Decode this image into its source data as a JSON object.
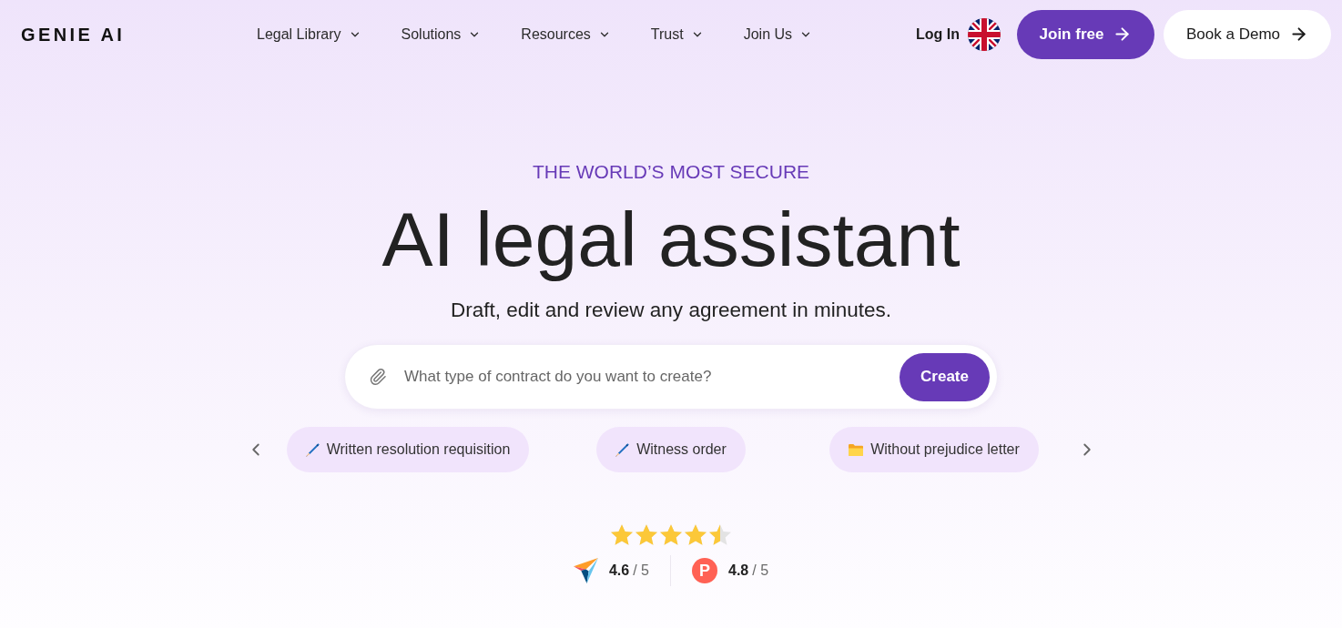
{
  "header": {
    "logo": "GENIE AI",
    "nav": [
      "Legal Library",
      "Solutions",
      "Resources",
      "Trust",
      "Join Us"
    ],
    "login": "Log In",
    "join_button": "Join free",
    "demo_button": "Book a Demo"
  },
  "hero": {
    "eyebrow": "THE WORLD’S MOST SECURE",
    "title": "AI legal assistant",
    "subtitle": "Draft, edit and review any agreement in minutes.",
    "prompt": {
      "placeholder": "What type of contract do you want to create?",
      "button": "Create"
    },
    "suggestions": [
      {
        "kind": "pen",
        "label": "Written resolution requisition"
      },
      {
        "kind": "pen",
        "label": "Witness order"
      },
      {
        "kind": "folder",
        "label": "Without prejudice letter"
      }
    ],
    "rating": {
      "stars": 4.5,
      "sources": [
        {
          "kind": "triangle",
          "score": "4.6",
          "out_of": "/ 5"
        },
        {
          "kind": "letter",
          "letter": "P",
          "score": "4.8",
          "out_of": "/ 5"
        }
      ]
    }
  }
}
